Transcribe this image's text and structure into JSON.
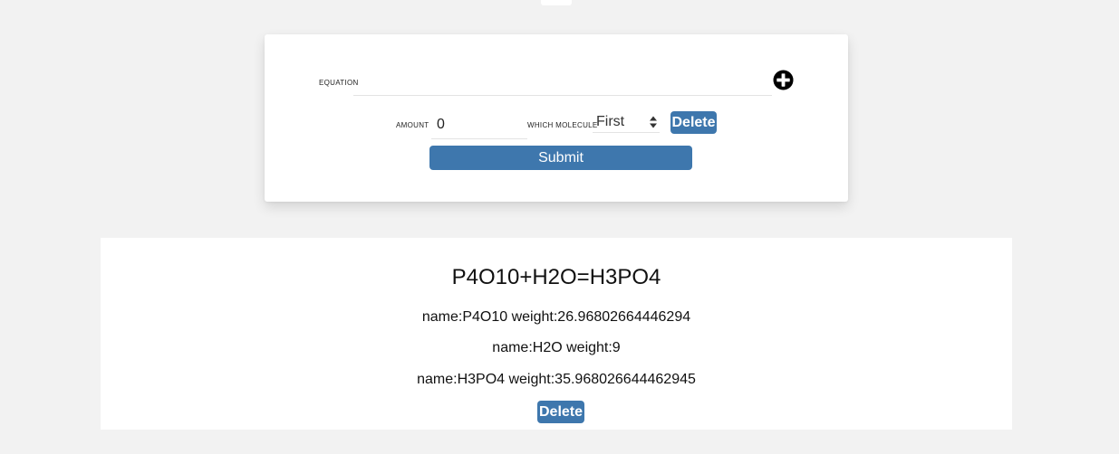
{
  "form": {
    "equation_label": "EQUATION",
    "equation_value": "",
    "amount_label": "AMOUNT",
    "amount_value": "0",
    "molecule_label": "WHICH MOLECULE",
    "molecule_selected": "First",
    "delete_label": "Delete",
    "submit_label": "Submit",
    "add_icon": "plus-circle-icon"
  },
  "result": {
    "equation": "P4O10+H2O=H3PO4",
    "lines": [
      "name:P4O10 weight:26.96802664446294",
      "name:H2O weight:9",
      "name:H3PO4 weight:35.968026644462945"
    ],
    "delete_label": "Delete"
  },
  "colors": {
    "background": "#f2f2f2",
    "button": "#3e77ad",
    "card": "#ffffff"
  }
}
